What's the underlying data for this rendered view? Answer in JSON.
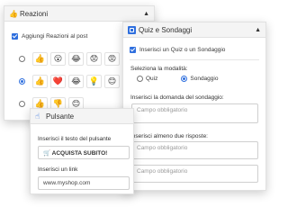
{
  "reactions_panel": {
    "title": "Reazioni",
    "checkbox_label": "Aggiungi Reazioni al post",
    "rows": [
      [
        "👍",
        "😮",
        "😂",
        "😟",
        "😡"
      ],
      [
        "👍",
        "❤️",
        "😂",
        "💡",
        "😊"
      ],
      [
        "👍",
        "👎",
        "😊"
      ]
    ]
  },
  "quiz_panel": {
    "title": "Quiz e Sondaggi",
    "checkbox_label": "Inserisci un Quiz o un Sondaggio",
    "mode_label": "Seleziona la modalità:",
    "mode_options": [
      "Quiz",
      "Sondaggio"
    ],
    "mode_selected": "Sondaggio",
    "question_label": "Inserisci la domanda del sondaggio:",
    "question_placeholder": "Campo obbligatorio",
    "answers_label": "Inserisci almeno due risposte:",
    "answer1_placeholder": "Campo obbligatorio",
    "answer2_placeholder": "Campo obbligatorio"
  },
  "button_panel": {
    "title": "Pulsante",
    "text_label": "Inserisci il testo del pulsante",
    "text_value": "🛒 ACQUISTA SUBITO!",
    "link_label": "Inserisci un link",
    "link_value": "www.myshop.com"
  },
  "colors": {
    "accent": "#2f6fde",
    "header_bg": "#f4f4f4",
    "border": "#e1e1e1"
  }
}
